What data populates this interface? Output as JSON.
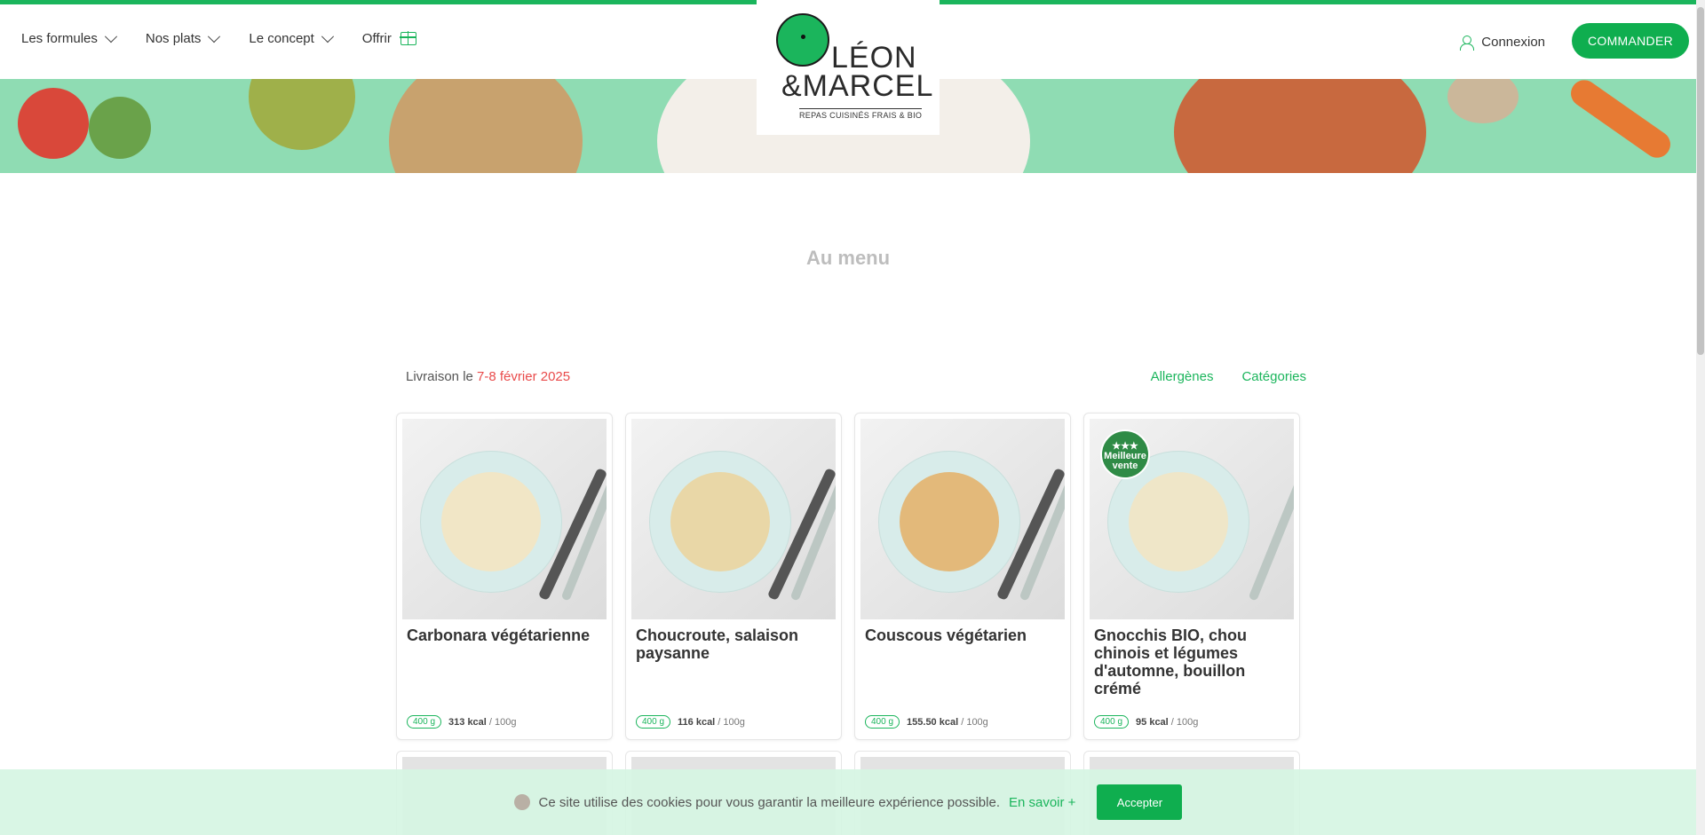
{
  "nav": {
    "formules": "Les formules",
    "plats": "Nos plats",
    "concept": "Le concept",
    "offrir": "Offrir"
  },
  "logo": {
    "line1": "LÉON",
    "line2": "&MARCEL",
    "tagline": "REPAS CUISINÉS FRAIS & BIO"
  },
  "header": {
    "login": "Connexion",
    "order": "COMMANDER"
  },
  "menu": {
    "title": "Au menu",
    "delivery_prefix": "Livraison le ",
    "delivery_date": "7-8 février 2025",
    "allergens": "Allergènes",
    "categories": "Catégories"
  },
  "cards": [
    {
      "title": "Carbonara végétarienne",
      "weight": "400 g",
      "kcal": "313 kcal",
      "per": " / 100g",
      "food_color": "#f1e6c6"
    },
    {
      "title": "Choucroute, salaison paysanne",
      "weight": "400 g",
      "kcal": "116 kcal",
      "per": " / 100g",
      "food_color": "#e9d7a7"
    },
    {
      "title": "Couscous végétarien",
      "weight": "400 g",
      "kcal": "155.50 kcal",
      "per": " / 100g",
      "food_color": "#e3b97a"
    },
    {
      "title": "Gnocchis BIO, chou chinois et légumes d'automne, bouillon crémé",
      "weight": "400 g",
      "kcal": "95 kcal",
      "per": " / 100g",
      "food_color": "#efe6c8",
      "badge": "★★★ Meilleure vente"
    }
  ],
  "cookie": {
    "text": "Ce site utilise des cookies pour vous garantir la meilleure expérience possible.",
    "more": "En savoir +",
    "accept": "Accepter"
  },
  "colors": {
    "brand_green": "#1bb55c",
    "date_red": "#e94b4b"
  }
}
